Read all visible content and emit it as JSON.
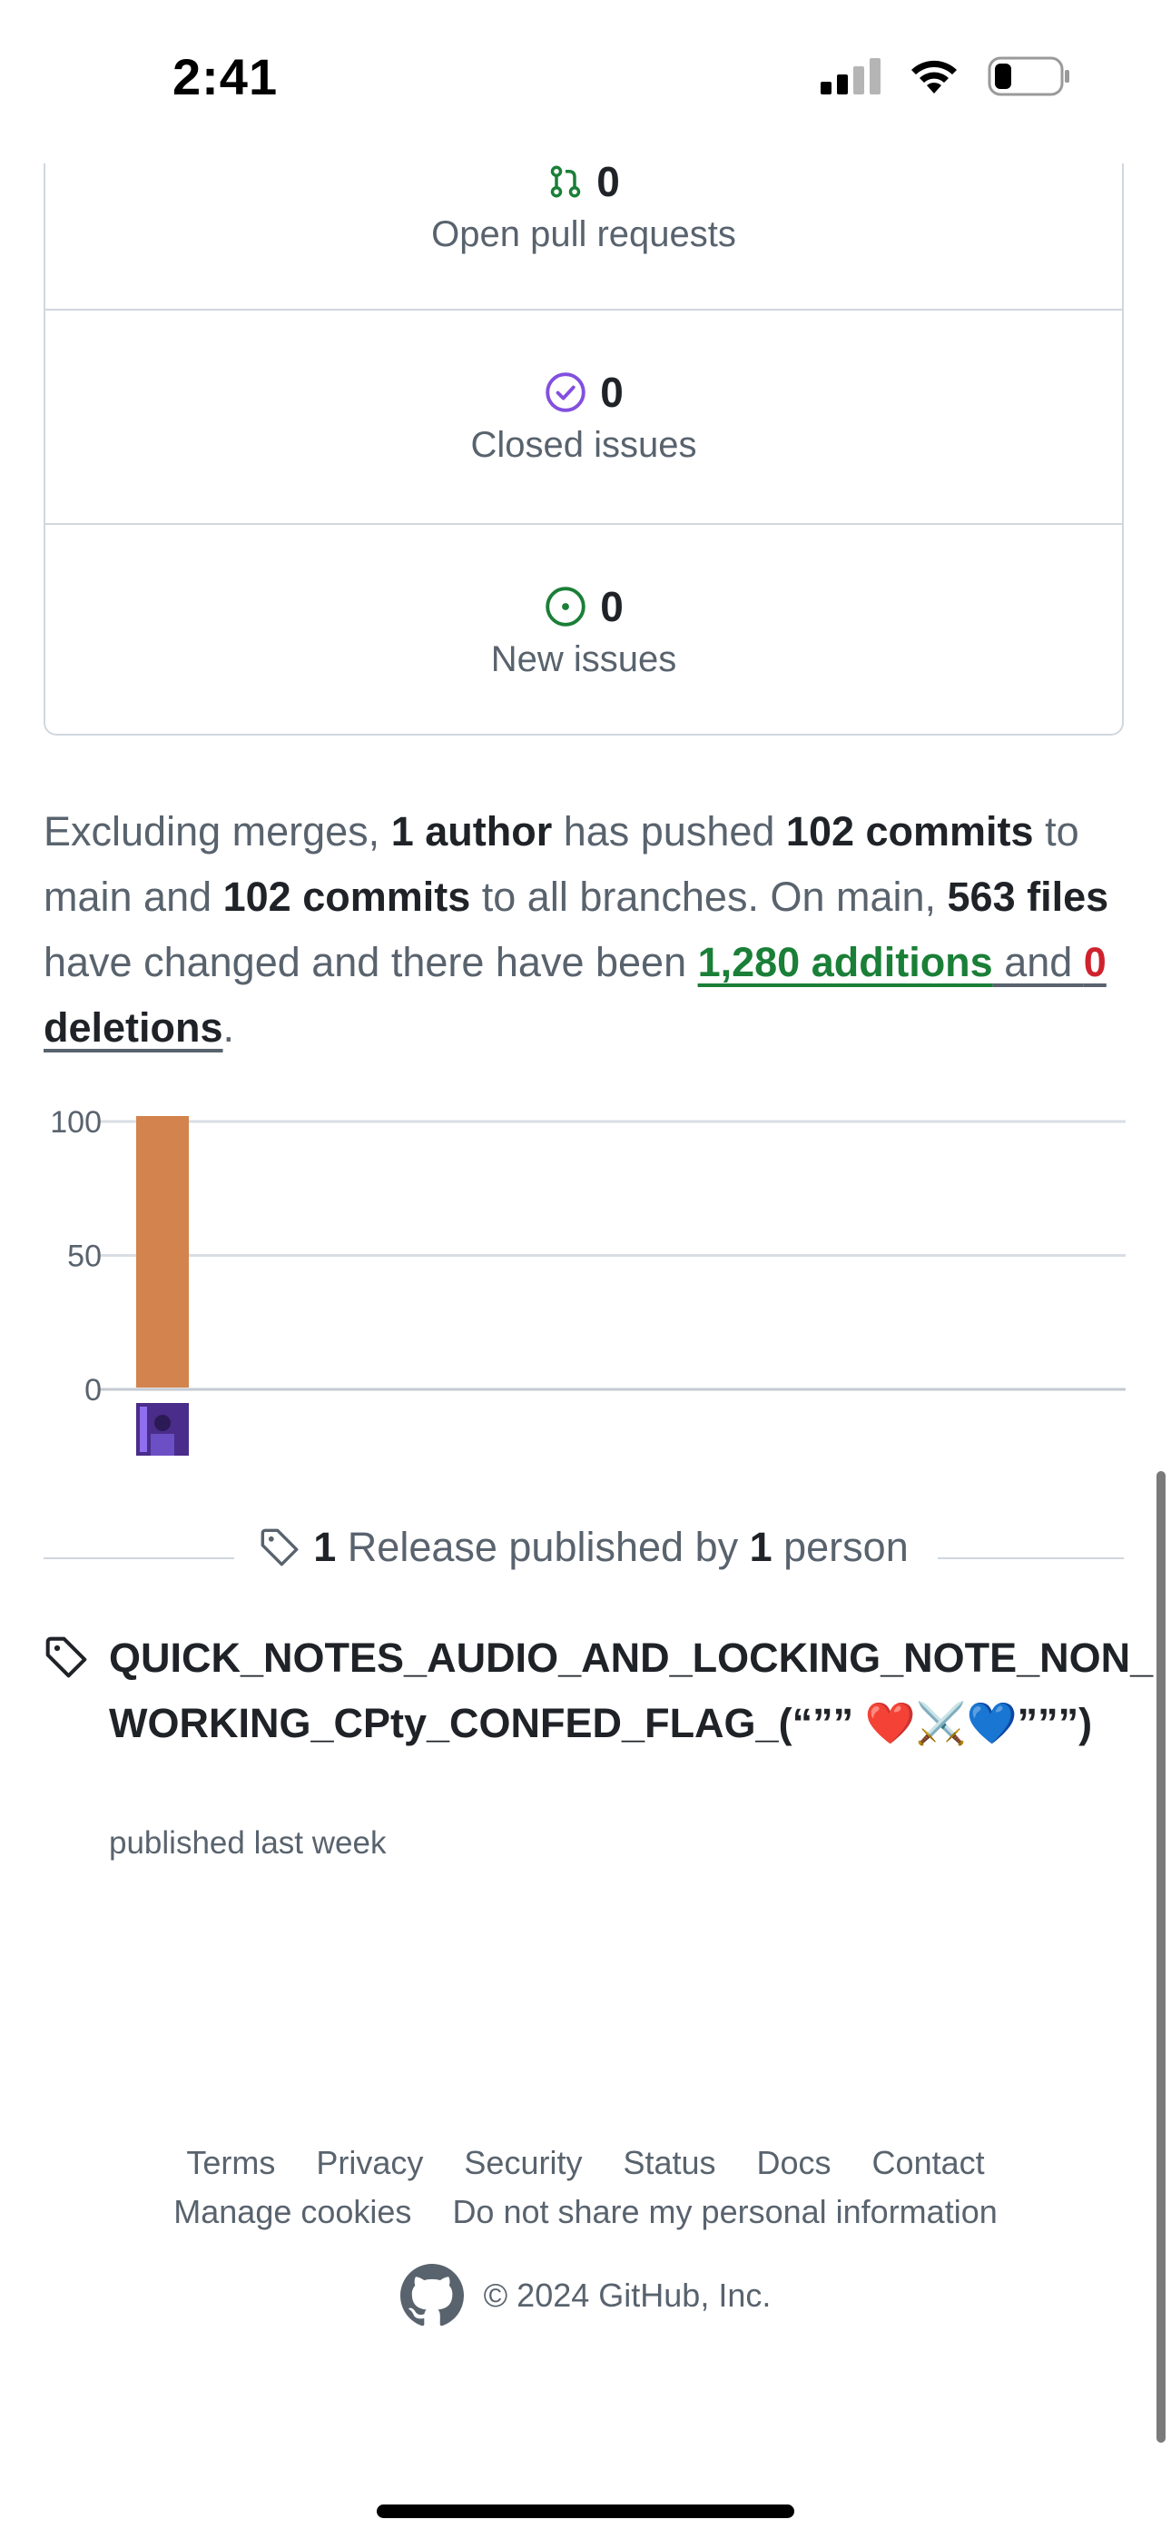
{
  "status_bar": {
    "time": "2:41"
  },
  "stats": [
    {
      "count": "0",
      "label": "Open pull requests",
      "icon": "git-pull-request-icon",
      "color": "#1a7f37"
    },
    {
      "count": "0",
      "label": "Closed issues",
      "icon": "issue-closed-icon",
      "color": "#8250df"
    },
    {
      "count": "0",
      "label": "New issues",
      "icon": "issue-opened-icon",
      "color": "#1a7f37"
    }
  ],
  "summary": {
    "p1": "Excluding merges, ",
    "authors": "1 author",
    "p2": " has pushed ",
    "commits_main": "102 commits",
    "p3": " to main and ",
    "commits_all": "102 commits",
    "p4": " to all branches. On main, ",
    "files": "563 files",
    "p5": " have changed and there have been ",
    "additions": "1,280 additions",
    "p6": " and ",
    "deletions_num": "0",
    "deletions_word": " deletions",
    "p7": "."
  },
  "chart_data": {
    "type": "bar",
    "categories": [
      "contributor"
    ],
    "values": [
      102
    ],
    "yticks": [
      "100",
      "50",
      "0"
    ],
    "ylim": [
      0,
      100
    ],
    "bar_color": "#d3834d"
  },
  "release": {
    "count": "1",
    "label": " Release published by ",
    "people": "1",
    "people_label": " person",
    "title": "QUICK_NOTES_AUDIO_AND_LOCKING_NOTE_NON_WORKING_CPty_CONFED_FLAG_(“”” ❤️⚔️💙”””)",
    "published": "published last week"
  },
  "footer": {
    "links_row1": [
      "Terms",
      "Privacy",
      "Security",
      "Status",
      "Docs",
      "Contact"
    ],
    "links_row2": [
      "Manage cookies",
      "Do not share my personal information"
    ],
    "copyright": "© 2024 GitHub, Inc."
  }
}
